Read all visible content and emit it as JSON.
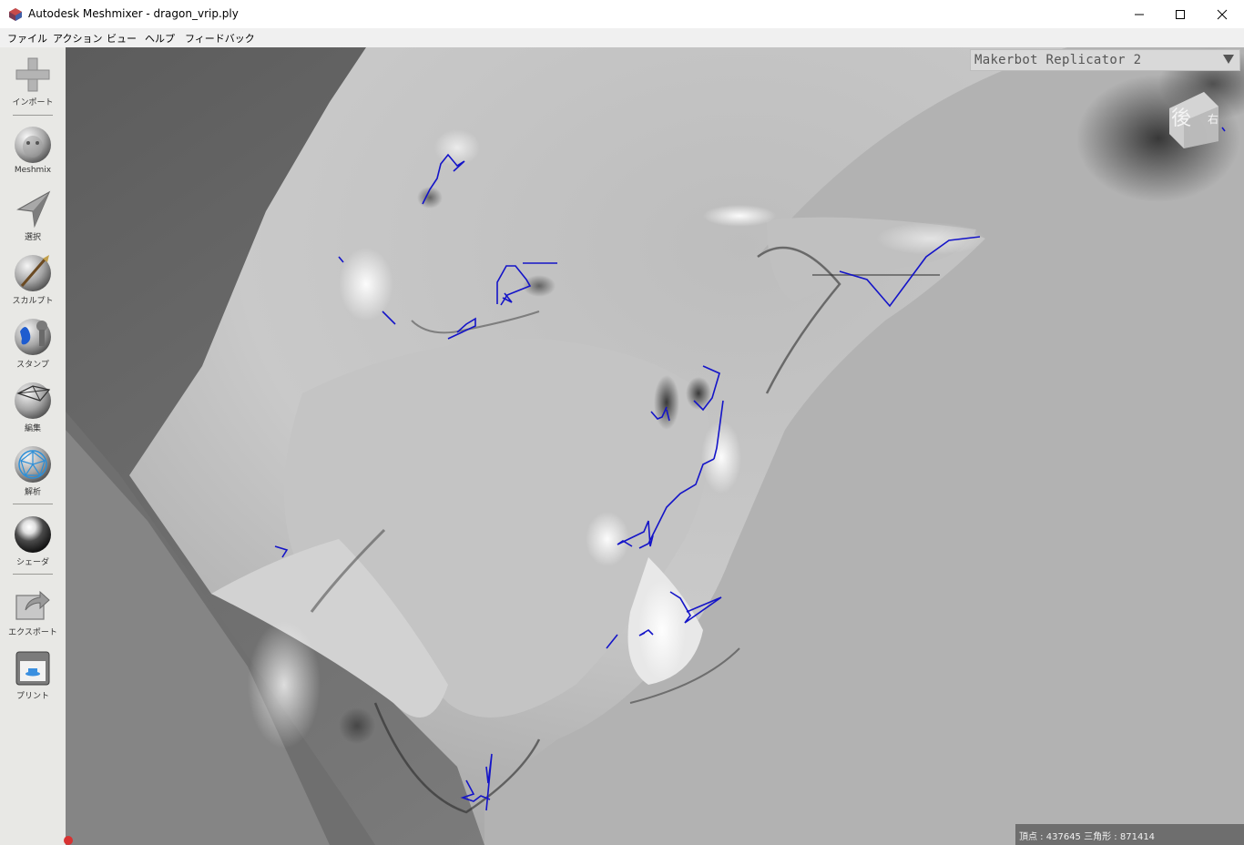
{
  "window": {
    "title": "Autodesk Meshmixer - dragon_vrip.ply",
    "minimize_glyph": "—",
    "maximize_glyph": "☐",
    "close_glyph": "✕"
  },
  "menu": {
    "items": [
      {
        "label": "ファイル"
      },
      {
        "label": "アクション"
      },
      {
        "label": "ビュー"
      },
      {
        "label": "ヘルプ"
      },
      {
        "label": "フィードバック"
      }
    ]
  },
  "toolbar": {
    "tools": [
      {
        "label": "インポート",
        "icon": "import-plus-icon"
      },
      {
        "label": "Meshmix",
        "icon": "meshmix-bunny-icon"
      },
      {
        "label": "選択",
        "icon": "select-arrow-icon"
      },
      {
        "label": "スカルプト",
        "icon": "sculpt-brush-icon"
      },
      {
        "label": "スタンプ",
        "icon": "stamp-icon"
      },
      {
        "label": "編集",
        "icon": "edit-icon"
      },
      {
        "label": "解析",
        "icon": "analysis-icon"
      },
      {
        "label": "シェーダ",
        "icon": "shader-sphere-icon"
      },
      {
        "label": "エクスポート",
        "icon": "export-icon"
      },
      {
        "label": "プリント",
        "icon": "print-icon"
      }
    ]
  },
  "viewport": {
    "printer": "Makerbot Replicator 2",
    "view_cube": {
      "face_label": "後",
      "side_label": "右"
    },
    "status": {
      "vertices_label": "頂点 :",
      "vertices_value": "437645",
      "triangles_label": "三角形 :",
      "triangles_value": "871414"
    },
    "colors": {
      "mesh_light": "#f4f4f4",
      "mesh_mid": "#b4b4b4",
      "mesh_dark": "#4a4a4a",
      "boundary_edges": "#1414c8"
    }
  }
}
